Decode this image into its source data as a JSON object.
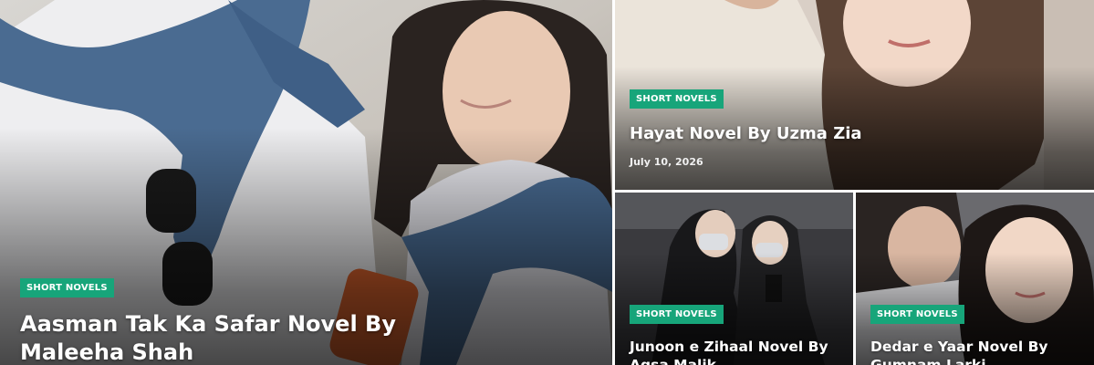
{
  "posts": [
    {
      "category": "SHORT NOVELS",
      "title": "Aasman Tak Ka Safar Novel By Maleeha Shah"
    },
    {
      "category": "SHORT NOVELS",
      "title": "Hayat Novel By Uzma Zia",
      "date": "July 10, 2026"
    },
    {
      "category": "SHORT NOVELS",
      "title": "Junoon e Zihaal Novel By Aqsa Malik"
    },
    {
      "category": "SHORT NOVELS",
      "title": "Dedar e Yaar Novel By Gumnam Larki"
    }
  ],
  "colors": {
    "badge": "#17a57a",
    "title": "#ffffff"
  }
}
